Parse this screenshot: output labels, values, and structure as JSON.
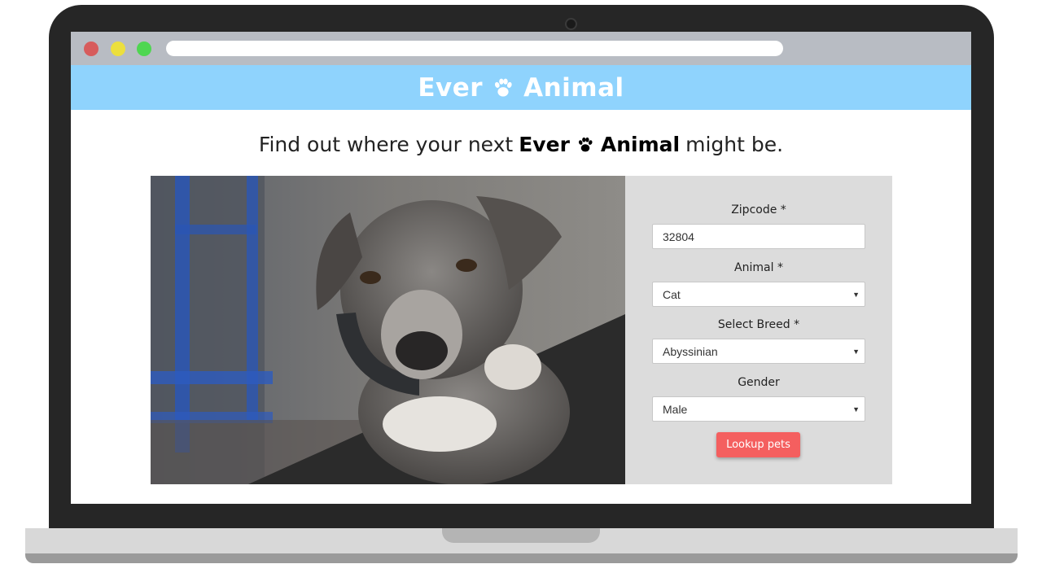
{
  "site": {
    "logo_left": "Ever",
    "logo_right": "Animal",
    "tagline_prefix": "Find out where your next",
    "tagline_brand_left": "Ever",
    "tagline_brand_right": "Animal",
    "tagline_suffix": "might be."
  },
  "form": {
    "zipcode_label": "Zipcode *",
    "zipcode_value": "32804",
    "animal_label": "Animal *",
    "animal_value": "Cat",
    "breed_label": "Select Breed *",
    "breed_value": "Abyssinian",
    "gender_label": "Gender",
    "gender_value": "Male",
    "submit_label": "Lookup pets"
  },
  "colors": {
    "header": "#8fd3fd",
    "button": "#f45f5f",
    "panel": "#dcdcdc"
  },
  "icons": {
    "logo": "paw-icon",
    "select": "chevron-down-icon"
  }
}
